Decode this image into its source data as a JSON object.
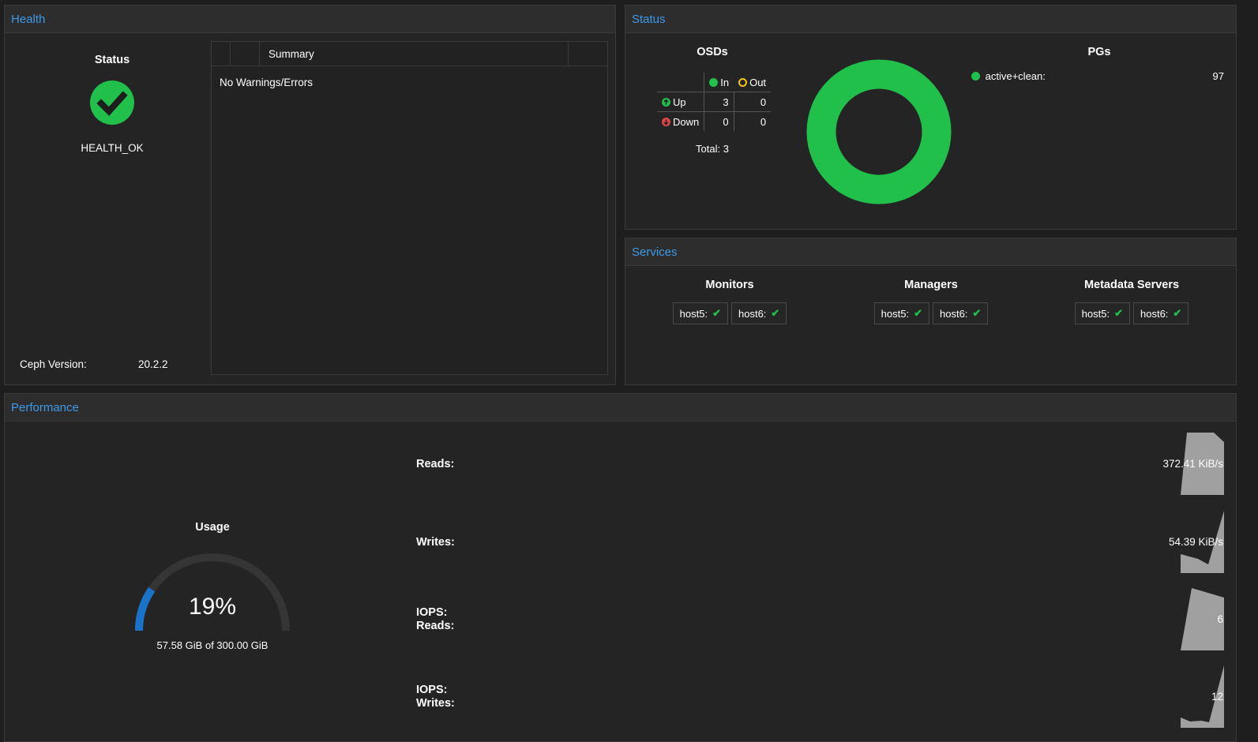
{
  "health": {
    "header": "Health",
    "status_title": "Status",
    "status_text": "HEALTH_OK",
    "summary_header": "Summary",
    "summary_empty": "No Warnings/Errors",
    "version_label": "Ceph Version:",
    "version_value": "20.2.2",
    "status_color": "#21c04b"
  },
  "status": {
    "header": "Status",
    "osds_title": "OSDs",
    "col_in": "In",
    "col_out": "Out",
    "row_up": "Up",
    "row_down": "Down",
    "up_in": "3",
    "up_out": "0",
    "down_in": "0",
    "down_out": "0",
    "total": "Total: 3",
    "pgs_title": "PGs",
    "pgs": [
      {
        "label": "active+clean:",
        "count": "97",
        "color": "#21c04b"
      }
    ]
  },
  "services": {
    "header": "Services",
    "groups": [
      {
        "title": "Monitors",
        "hosts": [
          "host5:",
          "host6:"
        ]
      },
      {
        "title": "Managers",
        "hosts": [
          "host5:",
          "host6:"
        ]
      },
      {
        "title": "Metadata Servers",
        "hosts": [
          "host5:",
          "host6:"
        ]
      }
    ]
  },
  "performance": {
    "header": "Performance",
    "usage_title": "Usage",
    "usage_percent": "19%",
    "usage_fraction": 0.19,
    "usage_detail": "57.58 GiB of 300.00 GiB",
    "metrics": [
      {
        "label_line1": "Reads:",
        "label_line2": "",
        "value": "372.41 KiB/s"
      },
      {
        "label_line1": "Writes:",
        "label_line2": "",
        "value": "54.39 KiB/s"
      },
      {
        "label_line1": "IOPS:",
        "label_line2": "Reads:",
        "value": "6"
      },
      {
        "label_line1": "IOPS:",
        "label_line2": "Writes:",
        "value": "12"
      }
    ],
    "gauge_color": "#1a73c8"
  },
  "colors": {
    "accent": "#3d9ae8",
    "ok": "#21c04b",
    "warn": "#f5c518",
    "down": "#e04545"
  }
}
